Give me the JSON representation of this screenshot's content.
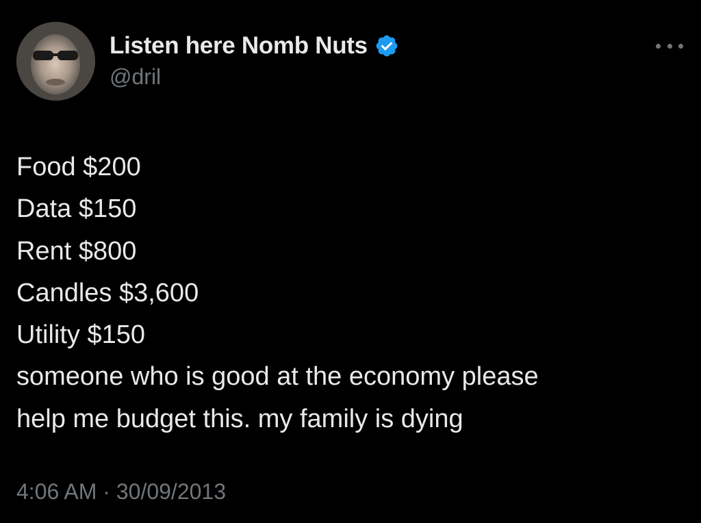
{
  "author": {
    "display_name": "Listen here Nomb Nuts",
    "handle": "@dril",
    "verified_icon": "verified-badge-icon",
    "verified_color": "#1d9bf0"
  },
  "menu": {
    "icon": "more-options-icon"
  },
  "tweet": {
    "lines": [
      "Food $200",
      "Data $150",
      "Rent $800",
      "Candles $3,600",
      "Utility $150",
      "someone who is good at the economy please",
      "help me budget this. my family is dying"
    ],
    "timestamp": "4:06 AM · 30/09/2013"
  },
  "colors": {
    "background": "#000000",
    "primary_text": "#e7e9ea",
    "secondary_text": "#71767b"
  }
}
